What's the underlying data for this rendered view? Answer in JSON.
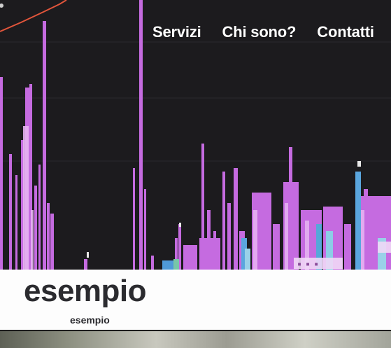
{
  "nav": {
    "items": [
      "Servizi",
      "Chi sono?",
      "Contatti"
    ]
  },
  "content": {
    "title": "esempio",
    "subtitle": "esempio"
  },
  "colors": {
    "hero_bg": "#1c1b1e",
    "waveform_purple": "#c56be0",
    "text_dark": "#2b2b2f"
  },
  "icons": {
    "hero": "audio-editor-timeline-image",
    "bottom": "landscape-photo"
  }
}
